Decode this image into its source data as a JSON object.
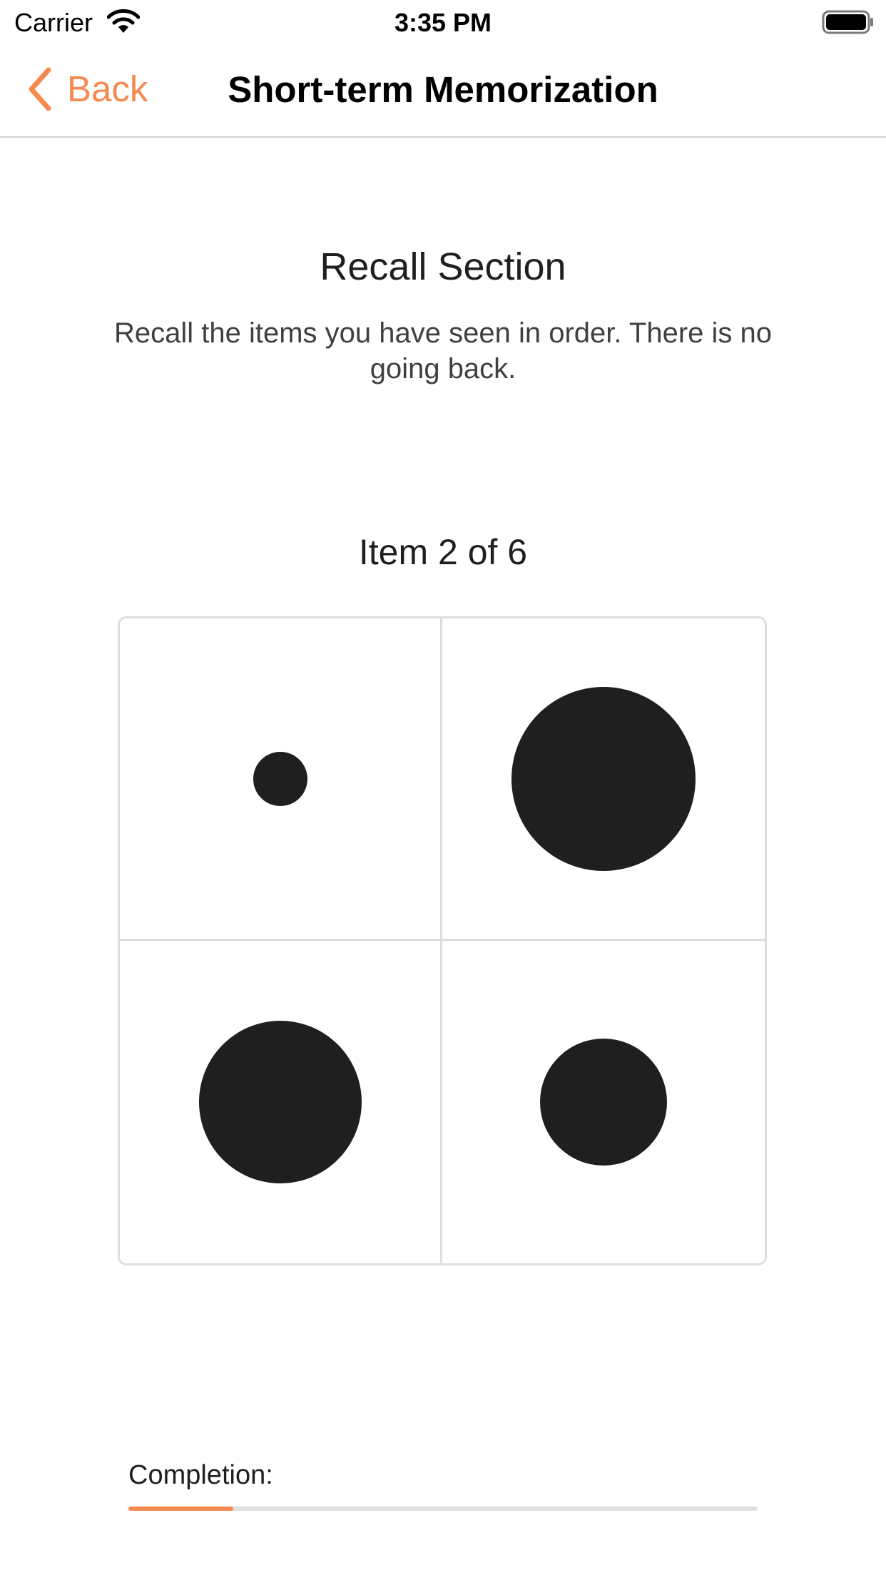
{
  "status_bar": {
    "carrier": "Carrier",
    "time": "3:35 PM"
  },
  "nav": {
    "back_label": "Back",
    "title": "Short-term Memorization"
  },
  "content": {
    "section_title": "Recall Section",
    "section_text": "Recall the items you have seen in order. There is no going back.",
    "item_counter": "Item 2 of 6",
    "cells": [
      {
        "dot": "small"
      },
      {
        "dot": "extra-large"
      },
      {
        "dot": "large"
      },
      {
        "dot": "medium"
      }
    ]
  },
  "completion": {
    "label": "Completion:",
    "progress": 0.167
  },
  "colors": {
    "accent": "#f5894f",
    "dot": "#1f1f1f",
    "grid_border": "#dedede"
  }
}
